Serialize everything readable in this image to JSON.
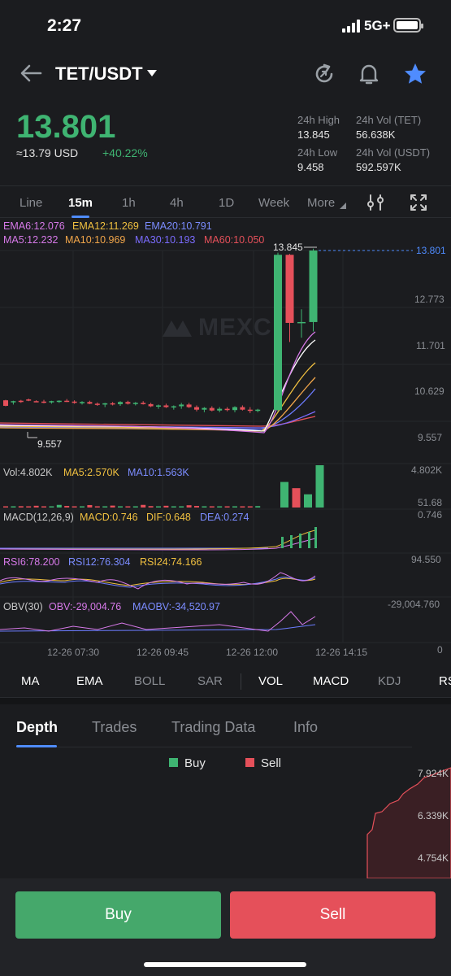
{
  "status_bar": {
    "time": "2:27",
    "network": "5G+"
  },
  "header": {
    "pair": "TET/USDT"
  },
  "ticker": {
    "price": "13.801",
    "usd_price": "≈13.79 USD",
    "change": "+40.22%",
    "high_label": "24h High",
    "high_value": "13.845",
    "low_label": "24h Low",
    "low_value": "9.458",
    "vol_tet_label": "24h Vol (TET)",
    "vol_tet_value": "56.638K",
    "vol_usdt_label": "24h Vol  (USDT)",
    "vol_usdt_value": "592.597K"
  },
  "timeframes": [
    "Line",
    "15m",
    "1h",
    "4h",
    "1D",
    "Week",
    "More"
  ],
  "active_timeframe": "15m",
  "indicators_main": {
    "ema6": "EMA6:12.076",
    "ema12": "EMA12:11.269",
    "ema20": "EMA20:10.791",
    "ma5": "MA5:12.232",
    "ma10": "MA10:10.969",
    "ma30": "MA30:10.193",
    "ma60": "MA60:10.050"
  },
  "chart_data": {
    "type": "candlestick",
    "price_axis": [
      "13.801",
      "12.773",
      "11.701",
      "10.629",
      "9.557"
    ],
    "high_marker": "13.845",
    "low_marker": "9.557",
    "current_price": "13.801",
    "time_axis": [
      "12-26 07:30",
      "12-26 09:45",
      "12-26 12:00",
      "12-26 14:15"
    ],
    "watermark": "MEXC",
    "candles": [
      {
        "o": 10.28,
        "h": 10.29,
        "l": 10.14,
        "c": 10.15
      },
      {
        "o": 10.24,
        "h": 10.27,
        "l": 10.18,
        "c": 10.26
      },
      {
        "o": 10.27,
        "h": 10.29,
        "l": 10.22,
        "c": 10.24
      },
      {
        "o": 10.3,
        "h": 10.32,
        "l": 10.26,
        "c": 10.28
      },
      {
        "o": 10.26,
        "h": 10.28,
        "l": 10.24,
        "c": 10.25
      },
      {
        "o": 10.25,
        "h": 10.29,
        "l": 10.21,
        "c": 10.23
      },
      {
        "o": 10.24,
        "h": 10.27,
        "l": 10.2,
        "c": 10.26
      },
      {
        "o": 10.26,
        "h": 10.28,
        "l": 10.22,
        "c": 10.27
      },
      {
        "o": 10.27,
        "h": 10.31,
        "l": 10.24,
        "c": 10.25
      },
      {
        "o": 10.25,
        "h": 10.28,
        "l": 10.2,
        "c": 10.22
      },
      {
        "o": 10.22,
        "h": 10.26,
        "l": 10.18,
        "c": 10.24
      },
      {
        "o": 10.24,
        "h": 10.27,
        "l": 10.19,
        "c": 10.2
      },
      {
        "o": 10.2,
        "h": 10.23,
        "l": 10.15,
        "c": 10.18
      },
      {
        "o": 10.18,
        "h": 10.22,
        "l": 10.12,
        "c": 10.21
      },
      {
        "o": 10.21,
        "h": 10.24,
        "l": 10.16,
        "c": 10.19
      },
      {
        "o": 10.19,
        "h": 10.26,
        "l": 10.15,
        "c": 10.24
      },
      {
        "o": 10.24,
        "h": 10.27,
        "l": 10.18,
        "c": 10.2
      },
      {
        "o": 10.2,
        "h": 10.24,
        "l": 10.16,
        "c": 10.22
      },
      {
        "o": 10.22,
        "h": 10.26,
        "l": 10.18,
        "c": 10.19
      },
      {
        "o": 10.19,
        "h": 10.22,
        "l": 10.12,
        "c": 10.14
      },
      {
        "o": 10.14,
        "h": 10.18,
        "l": 10.08,
        "c": 10.16
      },
      {
        "o": 10.16,
        "h": 10.2,
        "l": 10.1,
        "c": 10.12
      },
      {
        "o": 10.12,
        "h": 10.16,
        "l": 10.06,
        "c": 10.14
      },
      {
        "o": 10.14,
        "h": 10.22,
        "l": 10.08,
        "c": 10.18
      },
      {
        "o": 10.18,
        "h": 10.22,
        "l": 10.1,
        "c": 10.12
      },
      {
        "o": 10.12,
        "h": 10.16,
        "l": 10.02,
        "c": 10.06
      },
      {
        "o": 10.06,
        "h": 10.12,
        "l": 10.0,
        "c": 10.1
      },
      {
        "o": 10.1,
        "h": 10.14,
        "l": 10.02,
        "c": 10.04
      },
      {
        "o": 10.04,
        "h": 10.12,
        "l": 10.0,
        "c": 10.08
      },
      {
        "o": 10.08,
        "h": 10.12,
        "l": 10.02,
        "c": 10.05
      },
      {
        "o": 10.05,
        "h": 10.14,
        "l": 10.0,
        "c": 10.12
      },
      {
        "o": 10.12,
        "h": 10.16,
        "l": 10.04,
        "c": 10.06
      },
      {
        "o": 10.06,
        "h": 10.12,
        "l": 9.98,
        "c": 10.04
      },
      {
        "o": 10.04,
        "h": 10.08,
        "l": 10.0,
        "c": 10.06
      },
      {
        "o": 10.05,
        "h": 13.75,
        "l": 10.02,
        "c": 13.7
      },
      {
        "o": 13.7,
        "h": 13.72,
        "l": 11.65,
        "c": 12.1
      },
      {
        "o": 12.1,
        "h": 12.42,
        "l": 11.75,
        "c": 12.12
      },
      {
        "o": 12.12,
        "h": 13.845,
        "l": 11.9,
        "c": 13.801
      }
    ]
  },
  "volume": {
    "label": "Vol:4.802K",
    "ma5": "MA5:2.570K",
    "ma10": "MA10:1.563K",
    "axis_top": "4.802K",
    "axis_bottom": "51.68",
    "values": [
      0.12,
      0.1,
      0.15,
      0.08,
      0.2,
      0.1,
      0.12,
      0.3,
      0.18,
      0.08,
      0.1,
      0.28,
      0.14,
      0.1,
      0.22,
      0.08,
      0.12,
      0.1,
      0.3,
      0.16,
      0.1,
      0.2,
      0.12,
      0.1,
      0.26,
      0.18,
      0.1,
      0.14,
      0.12,
      0.08,
      0.1,
      0.12,
      0.14,
      0.16,
      2.9,
      2.2,
      1.5,
      4.802
    ]
  },
  "macd": {
    "label": "MACD(12,26,9)",
    "macd": "MACD:0.746",
    "dif": "DIF:0.648",
    "dea": "DEA:0.274",
    "axis_top": "0.746"
  },
  "rsi": {
    "rsi6": "RSI6:78.200",
    "rsi12": "RSI12:76.304",
    "rsi24": "RSI24:74.166",
    "axis_top": "94.550"
  },
  "obv": {
    "label": "OBV(30)",
    "obv": "OBV:-29,004.76",
    "maobv": "MAOBV:-34,520.97",
    "axis_top": "-29,004.760",
    "axis_bottom": "0"
  },
  "indicator_tabs": [
    "MA",
    "EMA",
    "BOLL",
    "SAR",
    "VOL",
    "MACD",
    "KDJ",
    "RS"
  ],
  "info_tabs": [
    "Depth",
    "Trades",
    "Trading Data",
    "Info"
  ],
  "depth": {
    "buy_label": "Buy",
    "sell_label": "Sell",
    "axis": [
      "7.924K",
      "6.339K",
      "4.754K"
    ]
  },
  "actions": {
    "buy": "Buy",
    "sell": "Sell"
  },
  "colors": {
    "up": "#3fb472",
    "down": "#e5505a",
    "accent": "#4f8cff"
  }
}
